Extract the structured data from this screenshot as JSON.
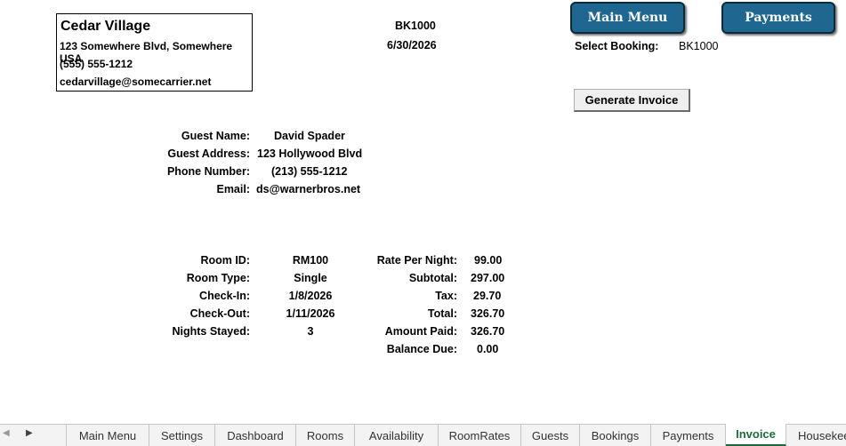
{
  "company": {
    "name": "Cedar Village",
    "address": "123 Somewhere Blvd, Somewhere USA",
    "phone": "(555) 555-1212",
    "email": "cedarvillage@somecarrier.net"
  },
  "header": {
    "booking_id": "BK1000",
    "date": "6/30/2026"
  },
  "buttons": {
    "main_menu": "Main Menu",
    "payments": "Payments",
    "generate_invoice": "Generate Invoice"
  },
  "select_booking": {
    "label": "Select Booking:",
    "value": "BK1000"
  },
  "guest": {
    "name_label": "Guest Name:",
    "name": "David Spader",
    "address_label": "Guest Address:",
    "address": "123 Hollywood Blvd",
    "phone_label": "Phone Number:",
    "phone": "(213) 555-1212",
    "email_label": "Email:",
    "email": "ds@warnerbros.net"
  },
  "room": {
    "room_id_label": "Room ID:",
    "room_id": "RM100",
    "room_type_label": "Room Type:",
    "room_type": "Single",
    "checkin_label": "Check-In:",
    "checkin": "1/8/2026",
    "checkout_label": "Check-Out:",
    "checkout": "1/11/2026",
    "nights_label": "Nights Stayed:",
    "nights": "3"
  },
  "charges": {
    "rate_label": "Rate Per Night:",
    "rate": "99.00",
    "subtotal_label": "Subtotal:",
    "subtotal": "297.00",
    "tax_label": "Tax:",
    "tax": "29.70",
    "total_label": "Total:",
    "total": "326.70",
    "paid_label": "Amount Paid:",
    "paid": "326.70",
    "balance_label": "Balance Due:",
    "balance": "0.00"
  },
  "sheet_tabs": [
    "Main Menu",
    "Settings",
    "Dashboard",
    "Rooms",
    "Availability",
    "RoomRates",
    "Guests",
    "Bookings",
    "Payments",
    "Invoice",
    "Housekee"
  ],
  "active_tab": "Invoice",
  "colors": {
    "nav_button": "#1f6690",
    "active_tab": "#1e6b3a"
  }
}
